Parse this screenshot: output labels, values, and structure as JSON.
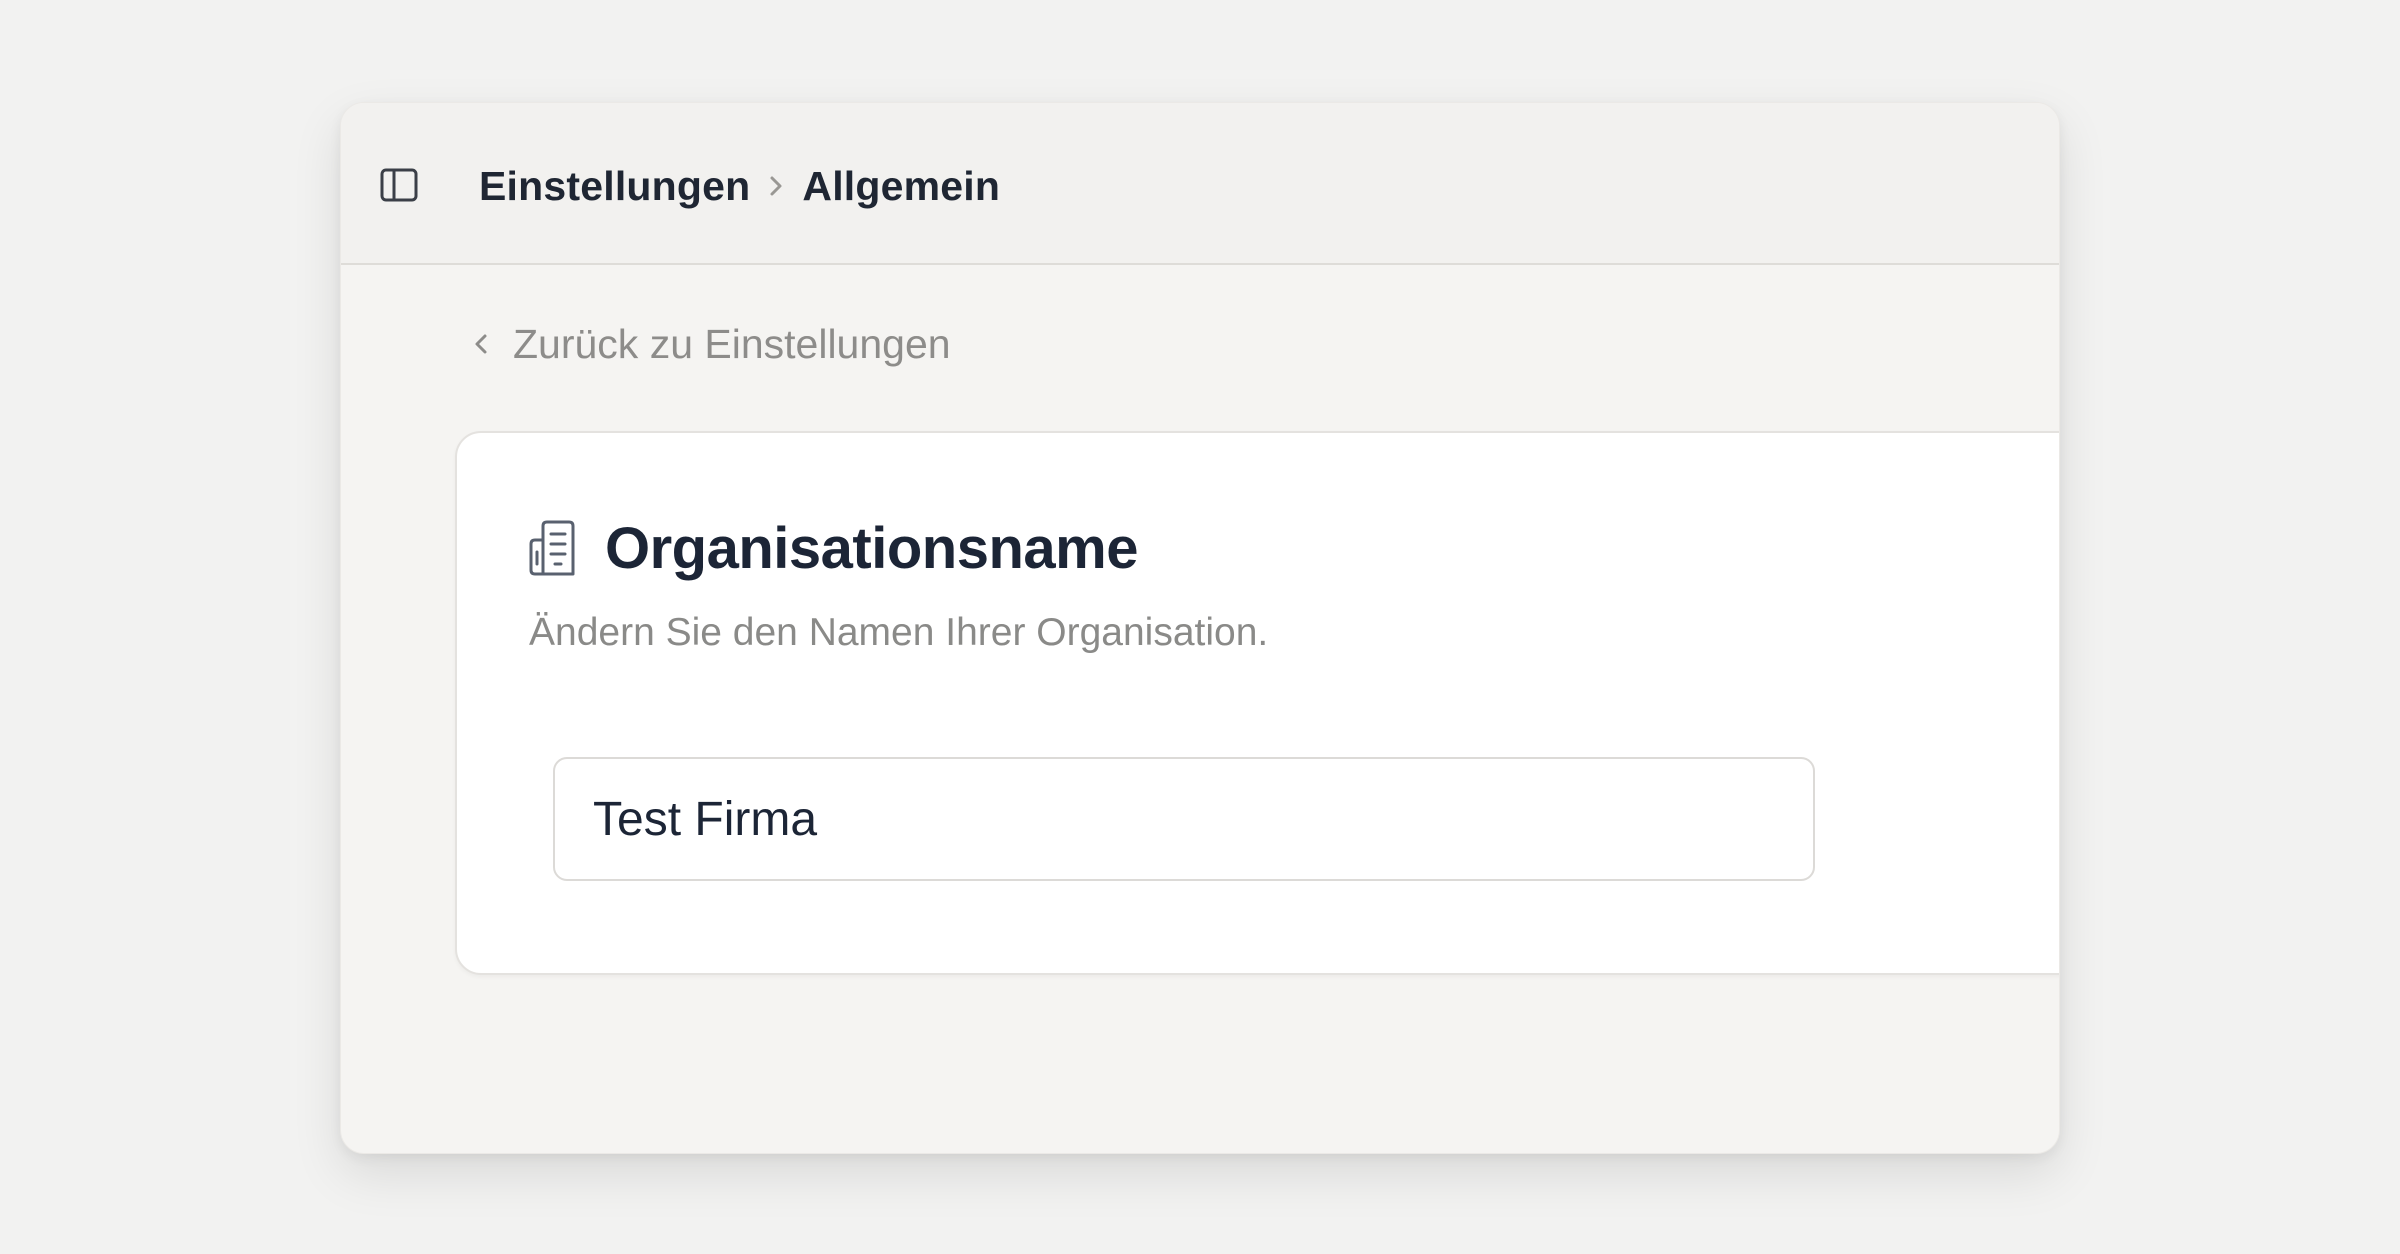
{
  "header": {
    "breadcrumb": [
      {
        "label": "Einstellungen"
      },
      {
        "label": "Allgemein"
      }
    ]
  },
  "back_link": {
    "label": "Zurück zu Einstellungen"
  },
  "card": {
    "icon": "building-icon",
    "title": "Organisationsname",
    "description": "Ändern Sie den Namen Ihrer Organisation.",
    "input": {
      "value": "Test Firma",
      "placeholder": ""
    }
  },
  "colors": {
    "page_bg": "#f2f2f1",
    "window_bg": "#f5f4f2",
    "card_bg": "#ffffff",
    "title_text": "#1c2536",
    "muted_text": "#8d8c8a"
  }
}
